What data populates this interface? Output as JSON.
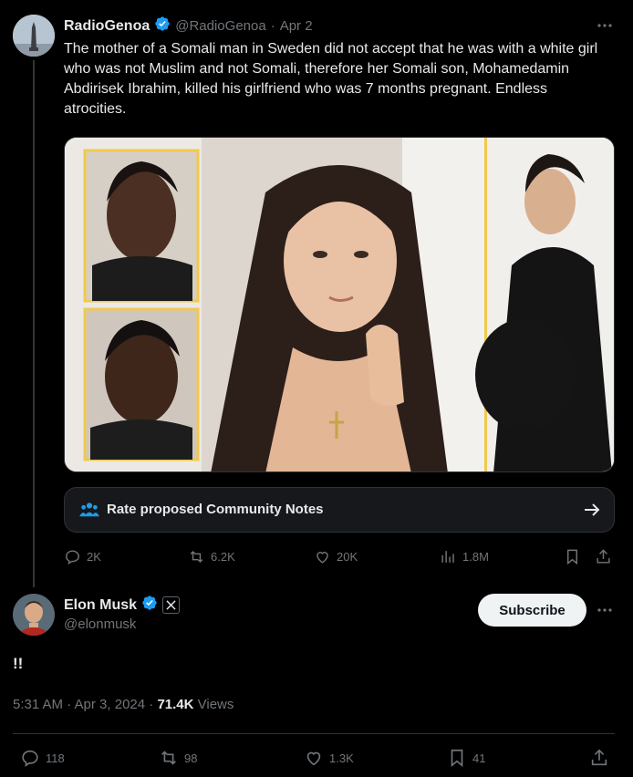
{
  "post": {
    "author_name": "RadioGenoa",
    "author_handle": "@RadioGenoa",
    "date": "Apr 2",
    "text": "The mother of a Somali man in Sweden did not accept that he was with a white girl who was not Muslim and not Somali, therefore her Somali son, Mohamedamin Abdirisek Ibrahim, killed his girlfriend who was 7 months pregnant. Endless atrocities.",
    "community_notes_label": "Rate proposed Community Notes",
    "stats": {
      "replies": "2K",
      "reposts": "6.2K",
      "likes": "20K",
      "views": "1.8M"
    }
  },
  "reply": {
    "author_name": "Elon Musk",
    "author_handle": "@elonmusk",
    "subscribe_label": "Subscribe",
    "text": "!!",
    "timestamp": "5:31 AM · Apr 3, 2024 · ",
    "views_count": "71.4K",
    "views_label": " Views",
    "stats": {
      "replies": "118",
      "reposts": "98",
      "likes": "1.3K",
      "bookmarks": "41"
    }
  },
  "colors": {
    "background": "#000000",
    "text": "#e7e9ea",
    "muted": "#71767b",
    "verified": "#1d9bf0",
    "media_frame": "#f2c94c"
  }
}
